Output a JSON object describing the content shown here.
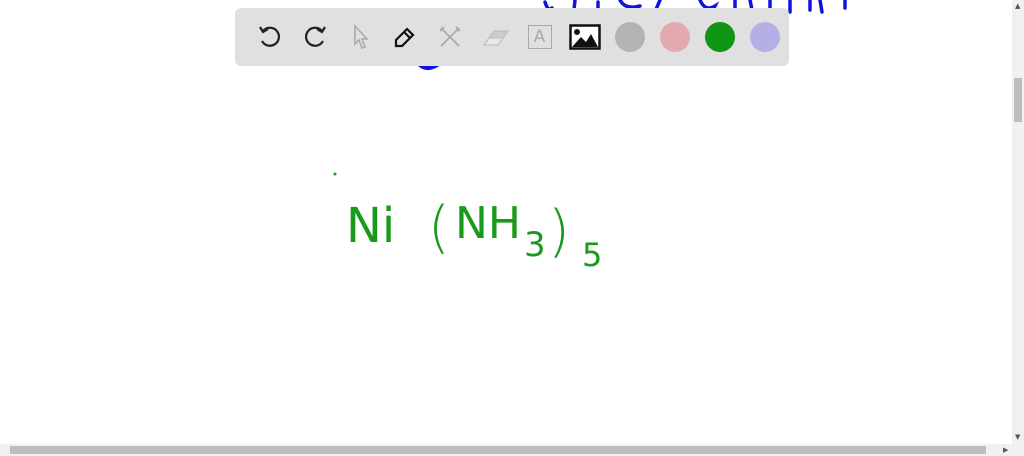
{
  "toolbar": {
    "tools": [
      {
        "name": "undo-icon",
        "enabled": true
      },
      {
        "name": "redo-icon",
        "enabled": true
      },
      {
        "name": "select-pointer-icon",
        "enabled": false
      },
      {
        "name": "pen-icon",
        "enabled": true
      },
      {
        "name": "tools-icon",
        "enabled": false
      },
      {
        "name": "eraser-icon",
        "enabled": false
      },
      {
        "name": "text-icon",
        "enabled": false,
        "glyph": "A"
      },
      {
        "name": "image-icon",
        "enabled": true
      }
    ],
    "colors": [
      "#b3b3b3",
      "#e2aab0",
      "#0f9414",
      "#b4b0e6"
    ],
    "selected_color": "#0f9414"
  },
  "canvas": {
    "ink_color": "#1a9a1a",
    "top_ink_color": "#1010e0",
    "formula": {
      "element": "Ni",
      "open": "(",
      "ligand": "NH",
      "ligand_sub": "3",
      "close": ")",
      "count": "5"
    }
  }
}
